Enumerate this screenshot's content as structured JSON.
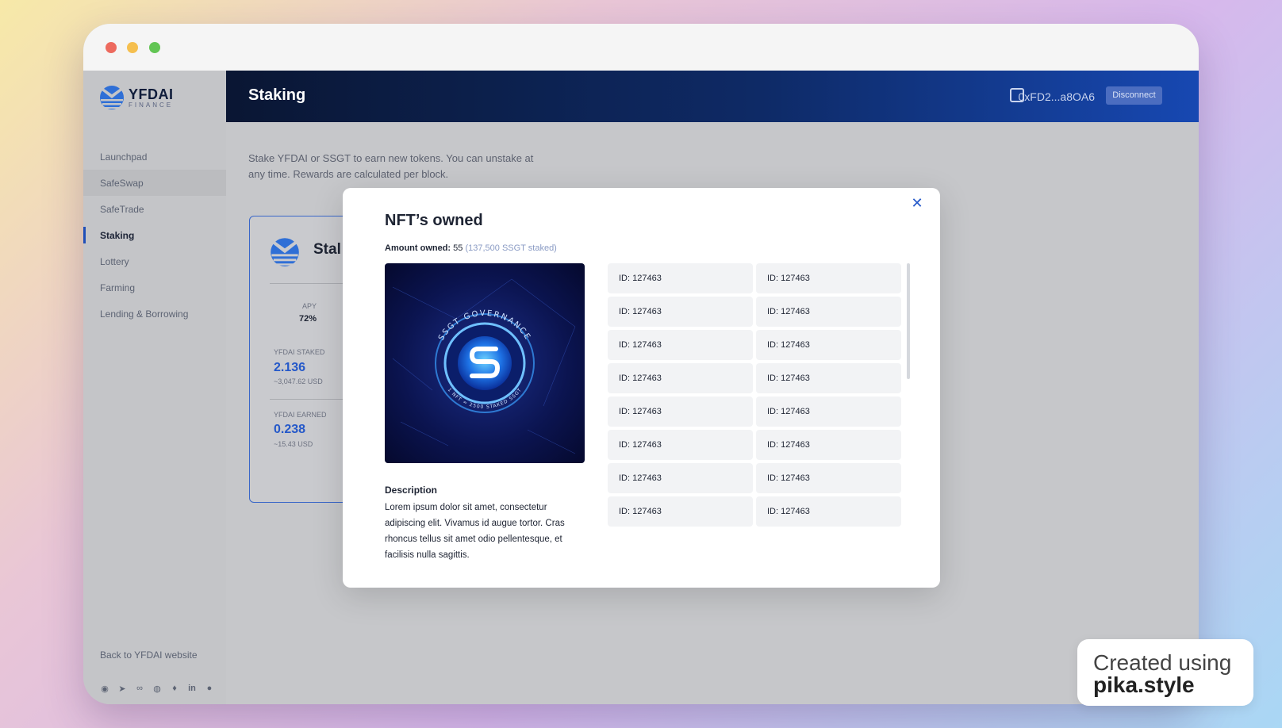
{
  "sidebar": {
    "logo_name": "YFDAI",
    "logo_sub": "FINANCE",
    "items": [
      {
        "label": "Launchpad"
      },
      {
        "label": "SafeSwap"
      },
      {
        "label": "SafeTrade"
      },
      {
        "label": "Staking"
      },
      {
        "label": "Lottery"
      },
      {
        "label": "Farming"
      },
      {
        "label": "Lending & Borrowing"
      }
    ],
    "active_item": "Staking",
    "back_link": "Back to YFDAI website",
    "social_icons": [
      "discord-icon",
      "telegram-icon",
      "link-icon",
      "reddit-icon",
      "twitter-icon",
      "linkedin-icon",
      "medium-icon"
    ]
  },
  "header": {
    "title": "Staking",
    "wallet_address": "0xFD2...a8OA6",
    "disconnect_label": "Disconnect"
  },
  "main": {
    "intro": "Stake YFDAI or SSGT to earn new tokens. You can unstake at any time. Rewards are calculated per block.",
    "card": {
      "title": "Stal",
      "apy_label": "APY",
      "apy_value": "72%",
      "staked_label": "YFDAI STAKED",
      "staked_value": "2.136",
      "staked_usd": "~3,047.62 USD",
      "earned_label": "YFDAI EARNED",
      "earned_value": "0.238",
      "earned_usd": "~15.43 USD"
    }
  },
  "modal": {
    "title": "NFT’s owned",
    "amount_label": "Amount owned:",
    "amount_value": "55",
    "amount_sub": "(137,500 SSGT staked)",
    "nft_caption_top": "SSGT GOVERNANCE",
    "nft_caption_bottom": "1 NFT = 2500 STAKED SSGT",
    "description_title": "Description",
    "description": "Lorem ipsum dolor sit amet, consectetur adipiscing elit. Vivamus id augue tortor. Cras rhoncus tellus sit amet odio pellentesque, et facilisis nulla sagittis.",
    "ids": [
      "ID: 127463",
      "ID: 127463",
      "ID: 127463",
      "ID: 127463",
      "ID: 127463",
      "ID: 127463",
      "ID: 127463",
      "ID: 127463",
      "ID: 127463",
      "ID: 127463",
      "ID: 127463",
      "ID: 127463",
      "ID: 127463",
      "ID: 127463",
      "ID: 127463",
      "ID: 127463"
    ]
  },
  "watermark": {
    "line1": "Created using",
    "line2": "pika.style"
  },
  "colors": {
    "accent": "#2458c9",
    "header_dark": "#0a1633",
    "header_light": "#1748b2"
  }
}
